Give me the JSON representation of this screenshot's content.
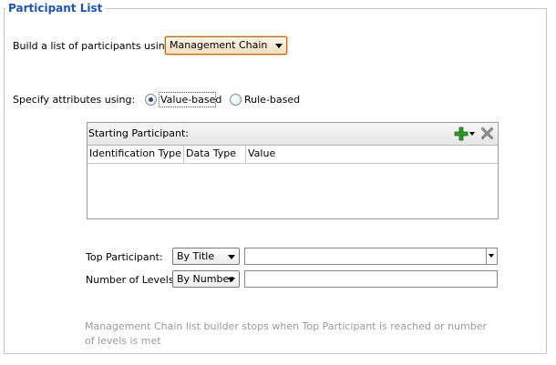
{
  "group": {
    "title": "Participant List"
  },
  "build": {
    "label": "Build a list of participants using:",
    "selected": "Management Chain"
  },
  "specify": {
    "label": "Specify attributes using:",
    "options": [
      {
        "label": "Value-based",
        "selected": true
      },
      {
        "label": "Rule-based",
        "selected": false
      }
    ]
  },
  "table": {
    "title": "Starting Participant:",
    "columns": [
      "Identification Type",
      "Data Type",
      "Value"
    ],
    "rows": []
  },
  "top_participant": {
    "label": "Top Participant:",
    "mode": "By Title",
    "value": ""
  },
  "levels": {
    "label": "Number of Levels:",
    "mode": "By Number",
    "value": ""
  },
  "hint": "Management Chain list builder stops when Top Participant is reached or number of levels is met",
  "colors": {
    "legend": "#1f56a8",
    "add_icon": "#2e9a2e",
    "delete_icon": "#8a8a8a",
    "select_border": "#b46a2b",
    "hint_text": "#9a9a9a"
  },
  "icons": {
    "add": "plus-icon",
    "add_menu": "chevron-down-icon",
    "delete": "close-icon"
  }
}
